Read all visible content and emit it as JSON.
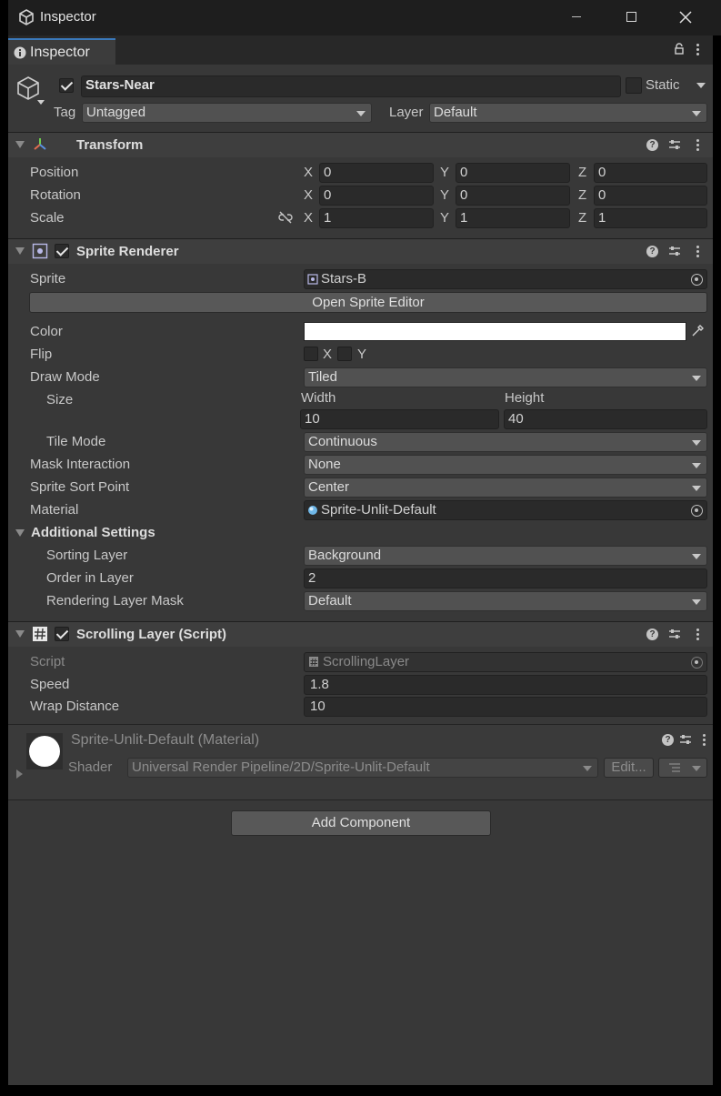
{
  "window": {
    "title": "Inspector",
    "icon": "unity-cube-icon",
    "minimize_label": "—",
    "maximize_label": "☐",
    "close_label": "✕"
  },
  "tab": {
    "label": "Inspector",
    "lock_icon": "lock-icon",
    "menu_icon": "kebab-menu-icon"
  },
  "gameobject": {
    "active": true,
    "name": "Stars-Near",
    "static_label": "Static",
    "tag_label": "Tag",
    "tag_value": "Untagged",
    "layer_label": "Layer",
    "layer_value": "Default"
  },
  "transform": {
    "title": "Transform",
    "rows": [
      {
        "label": "Position",
        "x": "0",
        "y": "0",
        "z": "0"
      },
      {
        "label": "Rotation",
        "x": "0",
        "y": "0",
        "z": "0"
      },
      {
        "label": "Scale",
        "x": "1",
        "y": "1",
        "z": "1"
      }
    ],
    "axis_x": "X",
    "axis_y": "Y",
    "axis_z": "Z"
  },
  "sprite_renderer": {
    "title": "Sprite Renderer",
    "enabled": true,
    "sprite_label": "Sprite",
    "sprite_value": "Stars-B",
    "open_editor_label": "Open Sprite Editor",
    "color_label": "Color",
    "color_value": "#ffffff",
    "flip_label": "Flip",
    "flip_x": "X",
    "flip_y": "Y",
    "draw_mode_label": "Draw Mode",
    "draw_mode_value": "Tiled",
    "size_label": "Size",
    "width_label": "Width",
    "height_label": "Height",
    "width_value": "10",
    "height_value": "40",
    "tile_mode_label": "Tile Mode",
    "tile_mode_value": "Continuous",
    "mask_label": "Mask Interaction",
    "mask_value": "None",
    "sort_point_label": "Sprite Sort Point",
    "sort_point_value": "Center",
    "material_label": "Material",
    "material_value": "Sprite-Unlit-Default",
    "additional_label": "Additional Settings",
    "sorting_layer_label": "Sorting Layer",
    "sorting_layer_value": "Background",
    "order_label": "Order in Layer",
    "order_value": "2",
    "rlm_label": "Rendering Layer Mask",
    "rlm_value": "Default"
  },
  "scrolling_layer": {
    "title": "Scrolling Layer (Script)",
    "enabled": true,
    "script_label": "Script",
    "script_value": "ScrollingLayer",
    "speed_label": "Speed",
    "speed_value": "1.8",
    "wrap_label": "Wrap Distance",
    "wrap_value": "10"
  },
  "material": {
    "title": "Sprite-Unlit-Default (Material)",
    "shader_label": "Shader",
    "shader_value": "Universal Render Pipeline/2D/Sprite-Unlit-Default",
    "edit_label": "Edit..."
  },
  "add_component_label": "Add Component"
}
